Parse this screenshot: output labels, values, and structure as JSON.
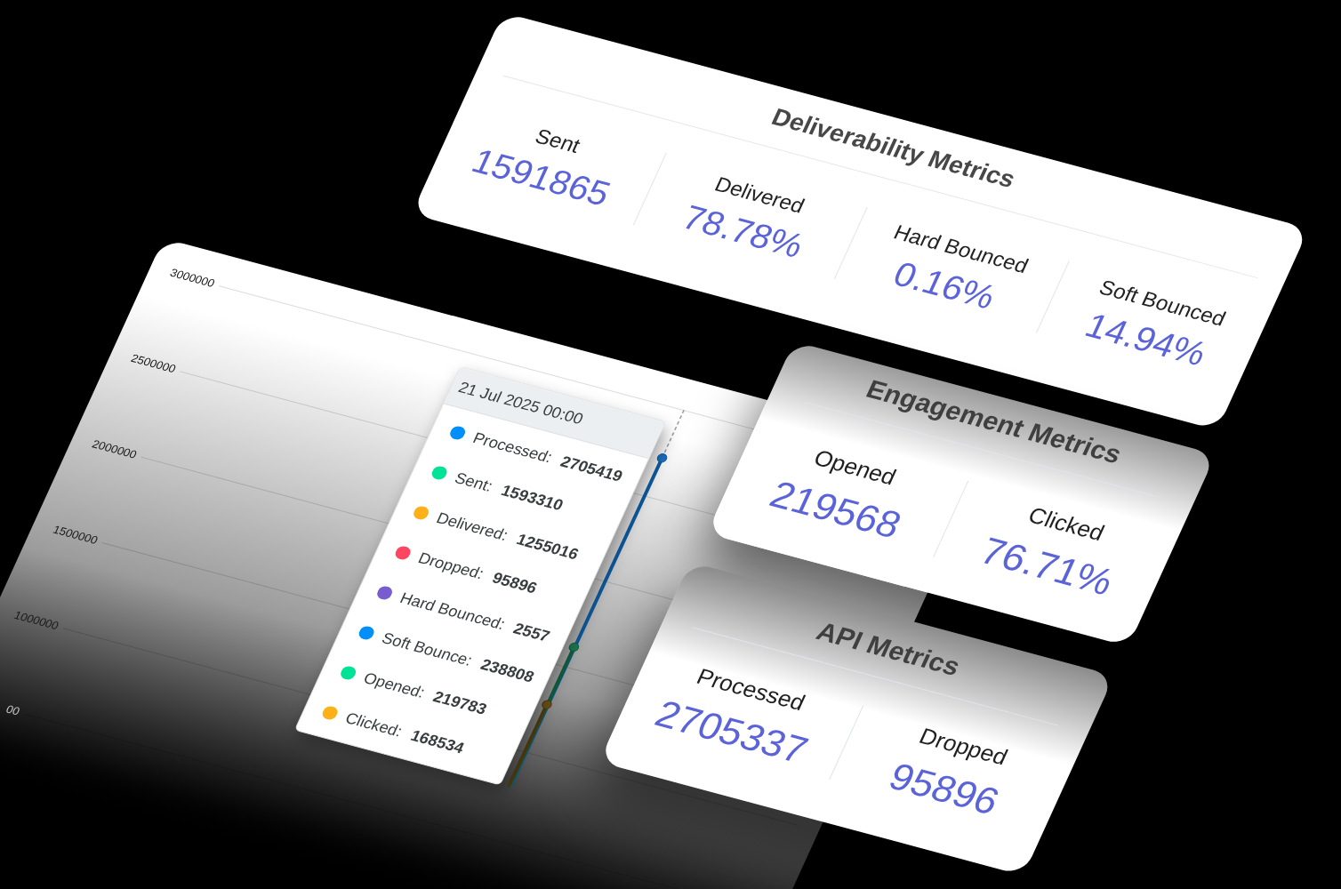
{
  "deliverability_metrics": {
    "title": "Deliverability Metrics",
    "metrics": [
      {
        "label": "Sent",
        "value": "1591865"
      },
      {
        "label": "Delivered",
        "value": "78.78%"
      },
      {
        "label": "Hard Bounced",
        "value": "0.16%"
      },
      {
        "label": "Soft Bounced",
        "value": "14.94%"
      }
    ]
  },
  "chart": {
    "y_axis_labels": [
      "3000000",
      "2500000",
      "2000000",
      "1500000",
      "1000000",
      "00"
    ],
    "tooltip": {
      "title": "21 Jul 2025 00:00",
      "items": [
        {
          "label": "Processed:",
          "value": "2705419",
          "color": "#008ffb"
        },
        {
          "label": "Sent:",
          "value": "1593310",
          "color": "#00e396"
        },
        {
          "label": "Delivered:",
          "value": "1255016",
          "color": "#feb019"
        },
        {
          "label": "Dropped:",
          "value": "95896",
          "color": "#ff4560"
        },
        {
          "label": "Hard Bounced:",
          "value": "2557",
          "color": "#775dd0"
        },
        {
          "label": "Soft Bounce:",
          "value": "238808",
          "color": "#008ffb"
        },
        {
          "label": "Opened:",
          "value": "219783",
          "color": "#00e396"
        },
        {
          "label": "Clicked:",
          "value": "168534",
          "color": "#feb019"
        }
      ]
    }
  },
  "engagement_metrics": {
    "title": "Engagement Metrics",
    "metrics": [
      {
        "label": "Opened",
        "value": "219568"
      },
      {
        "label": "Clicked",
        "value": "76.71%"
      }
    ]
  },
  "api_metrics": {
    "title": "API Metrics",
    "metrics": [
      {
        "label": "Processed",
        "value": "2705337"
      },
      {
        "label": "Dropped",
        "value": "95896"
      }
    ]
  }
}
